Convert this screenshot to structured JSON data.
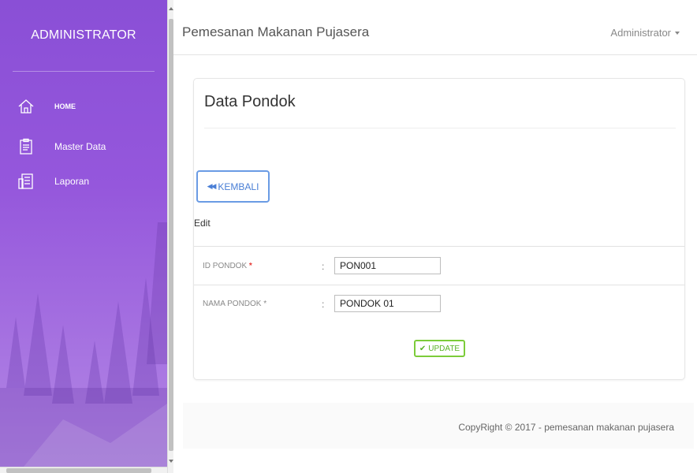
{
  "sidebar": {
    "brand": "ADMINISTRATOR",
    "items": [
      {
        "label": "HOME",
        "icon": "home-icon"
      },
      {
        "label": "Master Data",
        "icon": "clipboard-icon"
      },
      {
        "label": "Laporan",
        "icon": "report-icon"
      }
    ]
  },
  "header": {
    "title": "Pemesanan Makanan Pujasera",
    "user_menu": "Administrator"
  },
  "card": {
    "title": "Data Pondok",
    "back_button": "KEMBALI",
    "section": "Edit",
    "fields": [
      {
        "label": "ID PONDOK",
        "required_mark": "*",
        "colon": ":",
        "value": "PON001"
      },
      {
        "label": "NAMA PONDOK",
        "required_mark": "*",
        "colon": ":",
        "value": "PONDOK 01"
      }
    ],
    "update_button": "UPDATE"
  },
  "footer": {
    "copyright": "CopyRight © 2017 - pemesanan makanan pujasera"
  },
  "colors": {
    "sidebar_top": "#8a4fd6",
    "sidebar_bottom": "#b48ae6",
    "back_button": "#4a7fd6",
    "update_button": "#58b324",
    "required": "#e53935"
  }
}
